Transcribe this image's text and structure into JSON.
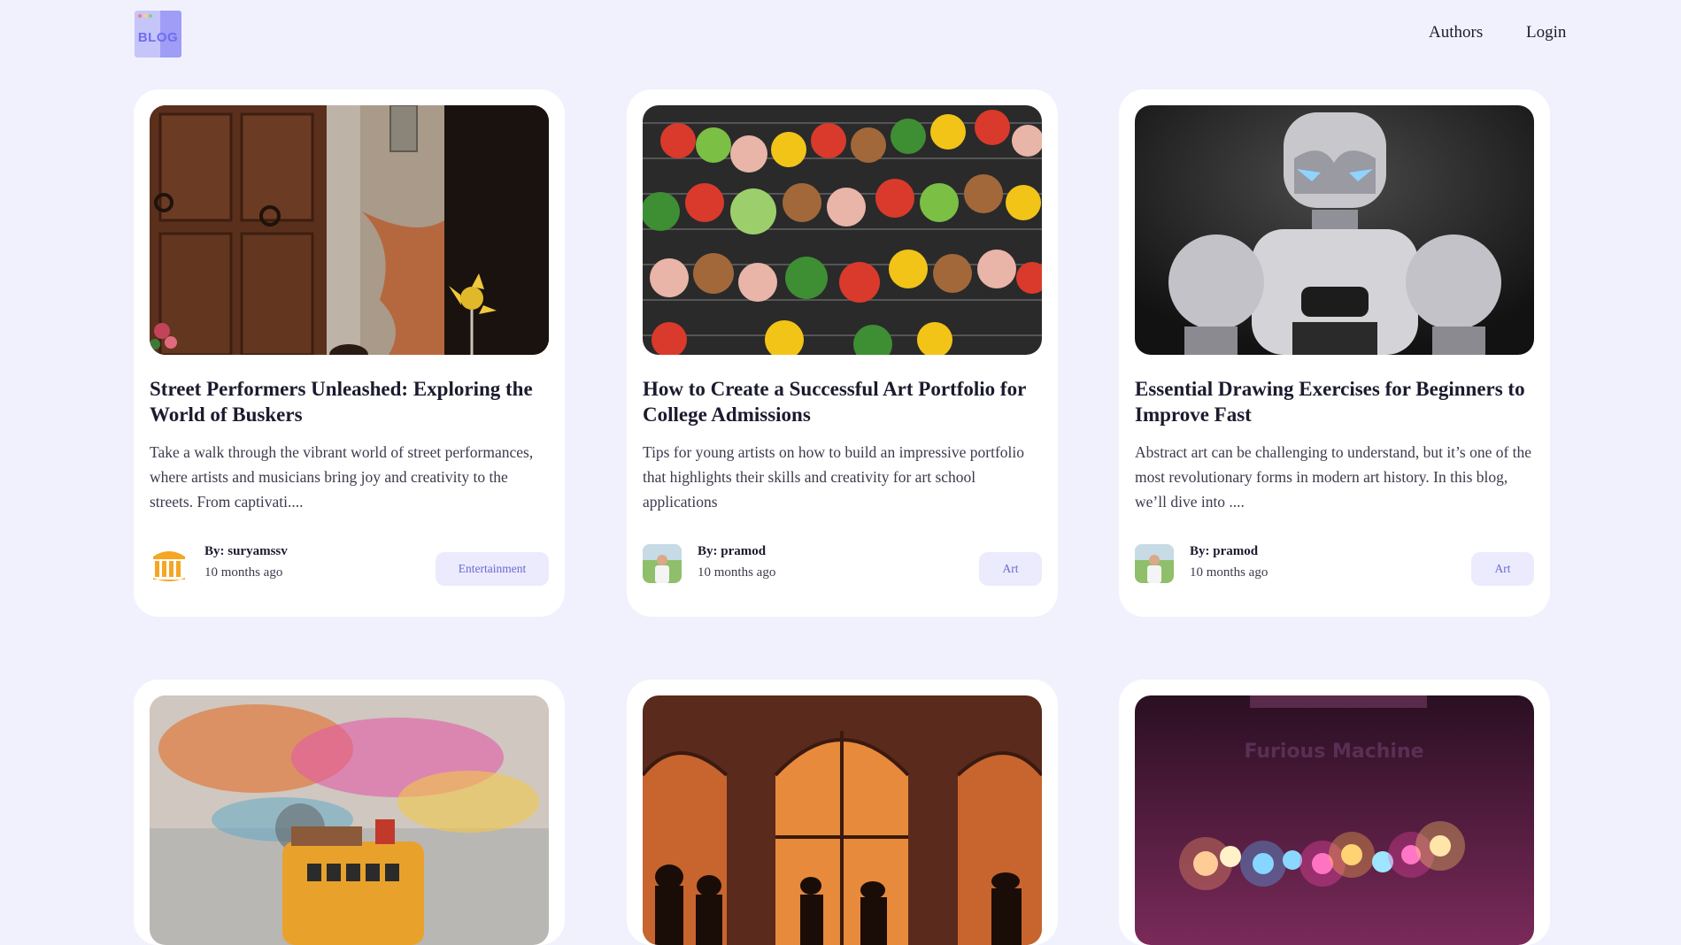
{
  "header": {
    "logo_text": "BLOG",
    "nav": {
      "authors": "Authors",
      "login": "Login"
    }
  },
  "colors": {
    "background": "#f1f1fd",
    "accent": "#6f6cf0",
    "tag_bg": "#ebebfd",
    "tag_text": "#6b6ad0"
  },
  "posts": [
    {
      "title": "Street Performers Unleashed: Exploring the World of Buskers",
      "excerpt": "Take a walk through the vibrant world of street performances, where artists and musicians bring joy and creativity to the streets. From captivati....",
      "author_prefix": "By: ",
      "author": "suryamssv",
      "date": "10 months ago",
      "tag": "Entertainment",
      "avatar_icon": "pillars-icon"
    },
    {
      "title": "How to Create a Successful Art Portfolio for College Admissions",
      "excerpt": "Tips for young artists on how to build an impressive portfolio that highlights their skills and creativity for art school applications",
      "author_prefix": "By: ",
      "author": "pramod",
      "date": "10 months ago",
      "tag": "Art",
      "avatar_icon": "person-photo"
    },
    {
      "title": "Essential Drawing Exercises for Beginners to Improve Fast",
      "excerpt": "Abstract art can be challenging to understand, but it’s one of the most revolutionary forms in modern art history. In this blog, we’ll dive into ....",
      "author_prefix": "By: ",
      "author": "pramod",
      "date": "10 months ago",
      "tag": "Art",
      "avatar_icon": "person-photo"
    }
  ],
  "stage_sign_text": "Furious Machine"
}
